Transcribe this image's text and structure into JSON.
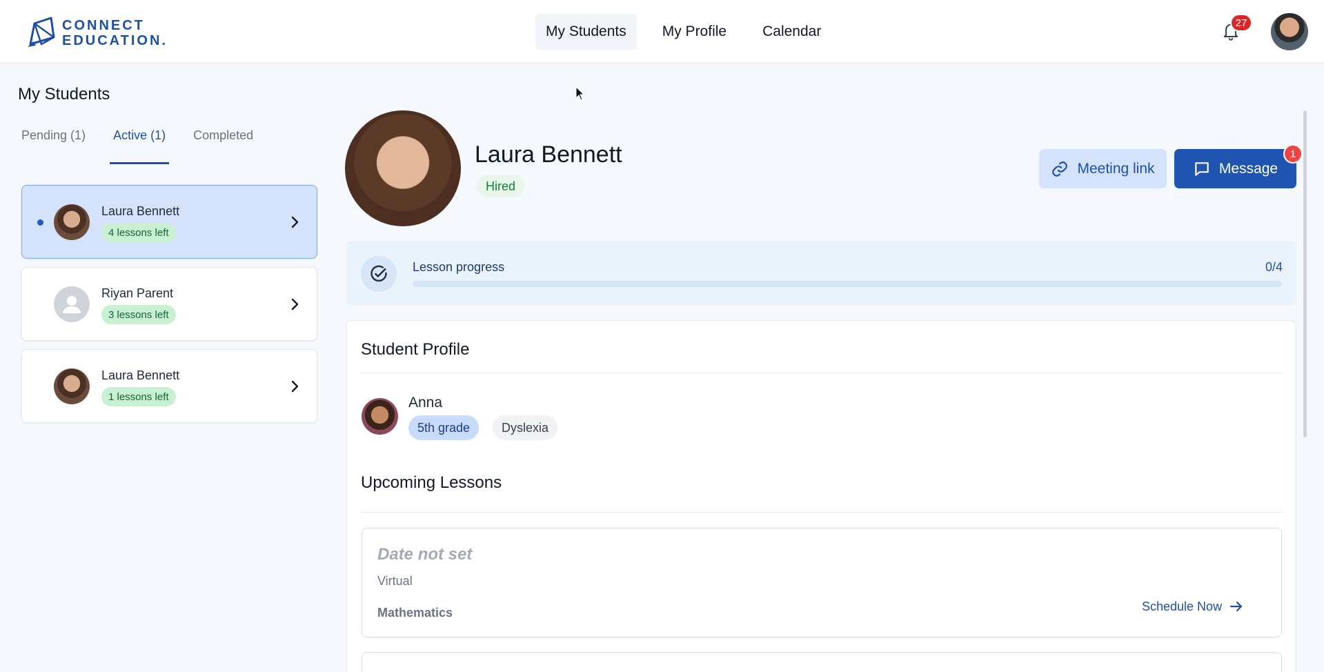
{
  "brand": {
    "line1": "CONNECT",
    "line2": "EDUCATION."
  },
  "nav": [
    "My Students",
    "My Profile",
    "Calendar"
  ],
  "header": {
    "notifications_count": "27"
  },
  "left": {
    "title": "My Students",
    "tabs": [
      "Pending (1)",
      "Active (1)",
      "Completed"
    ],
    "students": [
      {
        "name": "Laura Bennett",
        "badge": "4 lessons left"
      },
      {
        "name": "Riyan Parent",
        "badge": "3 lessons left"
      },
      {
        "name": "Laura Bennett",
        "badge": "1 lessons left"
      }
    ]
  },
  "profile": {
    "name": "Laura Bennett",
    "status": "Hired",
    "meeting_label": "Meeting link",
    "message_label": "Message",
    "message_badge": "1"
  },
  "progress": {
    "label": "Lesson progress",
    "count": "0/4",
    "fraction": 0
  },
  "student_profile": {
    "title": "Student Profile",
    "child_name": "Anna",
    "grade": "5th grade",
    "condition": "Dyslexia"
  },
  "lessons": {
    "title": "Upcoming Lessons",
    "items": [
      {
        "date": "Date not set",
        "mode": "Virtual",
        "subject": "Mathematics",
        "action": "Schedule Now"
      }
    ]
  },
  "colors": {
    "primary": "#1f55b0",
    "accent_light": "#d4e3fb",
    "success": "#15803d",
    "danger": "#dc2626"
  }
}
